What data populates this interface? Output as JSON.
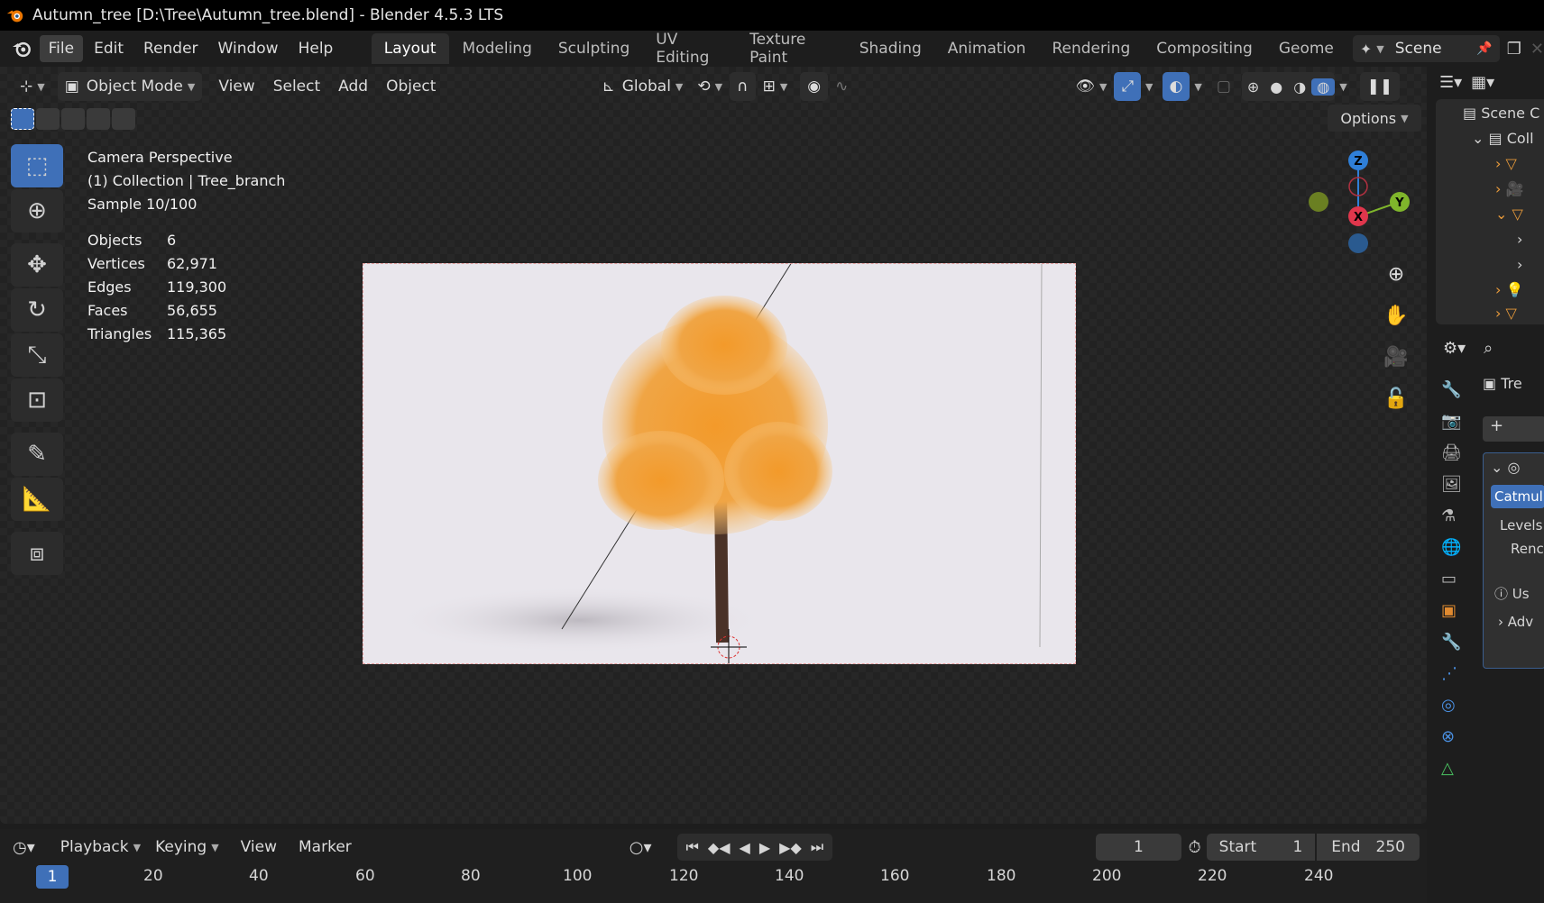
{
  "titlebar": {
    "title": "Autumn_tree [D:\\Tree\\Autumn_tree.blend] - Blender 4.5.3 LTS"
  },
  "menubar": {
    "items": [
      "File",
      "Edit",
      "Render",
      "Window",
      "Help"
    ],
    "workspaces": [
      "Layout",
      "Modeling",
      "Sculpting",
      "UV Editing",
      "Texture Paint",
      "Shading",
      "Animation",
      "Rendering",
      "Compositing",
      "Geome"
    ],
    "scene_label": "Scene"
  },
  "viewport_header": {
    "mode": "Object Mode",
    "menus": [
      "View",
      "Select",
      "Add",
      "Object"
    ],
    "orientation": "Global",
    "options_label": "Options"
  },
  "overlay": {
    "camera": "Camera Perspective",
    "collection": "(1) Collection | Tree_branch",
    "sample": "Sample 10/100",
    "stats": [
      {
        "label": "Objects",
        "value": "6"
      },
      {
        "label": "Vertices",
        "value": "62,971"
      },
      {
        "label": "Edges",
        "value": "119,300"
      },
      {
        "label": "Faces",
        "value": "56,655"
      },
      {
        "label": "Triangles",
        "value": "115,365"
      }
    ]
  },
  "gizmo": {
    "z": "Z",
    "y": "Y",
    "x": "X"
  },
  "outliner": {
    "items": [
      "Scene C",
      "Coll"
    ]
  },
  "properties": {
    "object_name": "Tre",
    "modifier": "Catmul",
    "levels": "Levels",
    "render": "Renc",
    "use": "Us",
    "adv": "Adv"
  },
  "timeline": {
    "menus": [
      "Playback",
      "Keying",
      "View",
      "Marker"
    ],
    "current_frame": "1",
    "start_label": "Start",
    "start_value": "1",
    "end_label": "End",
    "end_value": "250",
    "ruler": [
      "1",
      "20",
      "40",
      "60",
      "80",
      "100",
      "120",
      "140",
      "160",
      "180",
      "200",
      "220",
      "240"
    ]
  },
  "colors": {
    "accent": "#3f70b8",
    "z_axis": "#2f7fd8",
    "y_axis": "#7fb52b",
    "x_axis": "#e0364c"
  }
}
